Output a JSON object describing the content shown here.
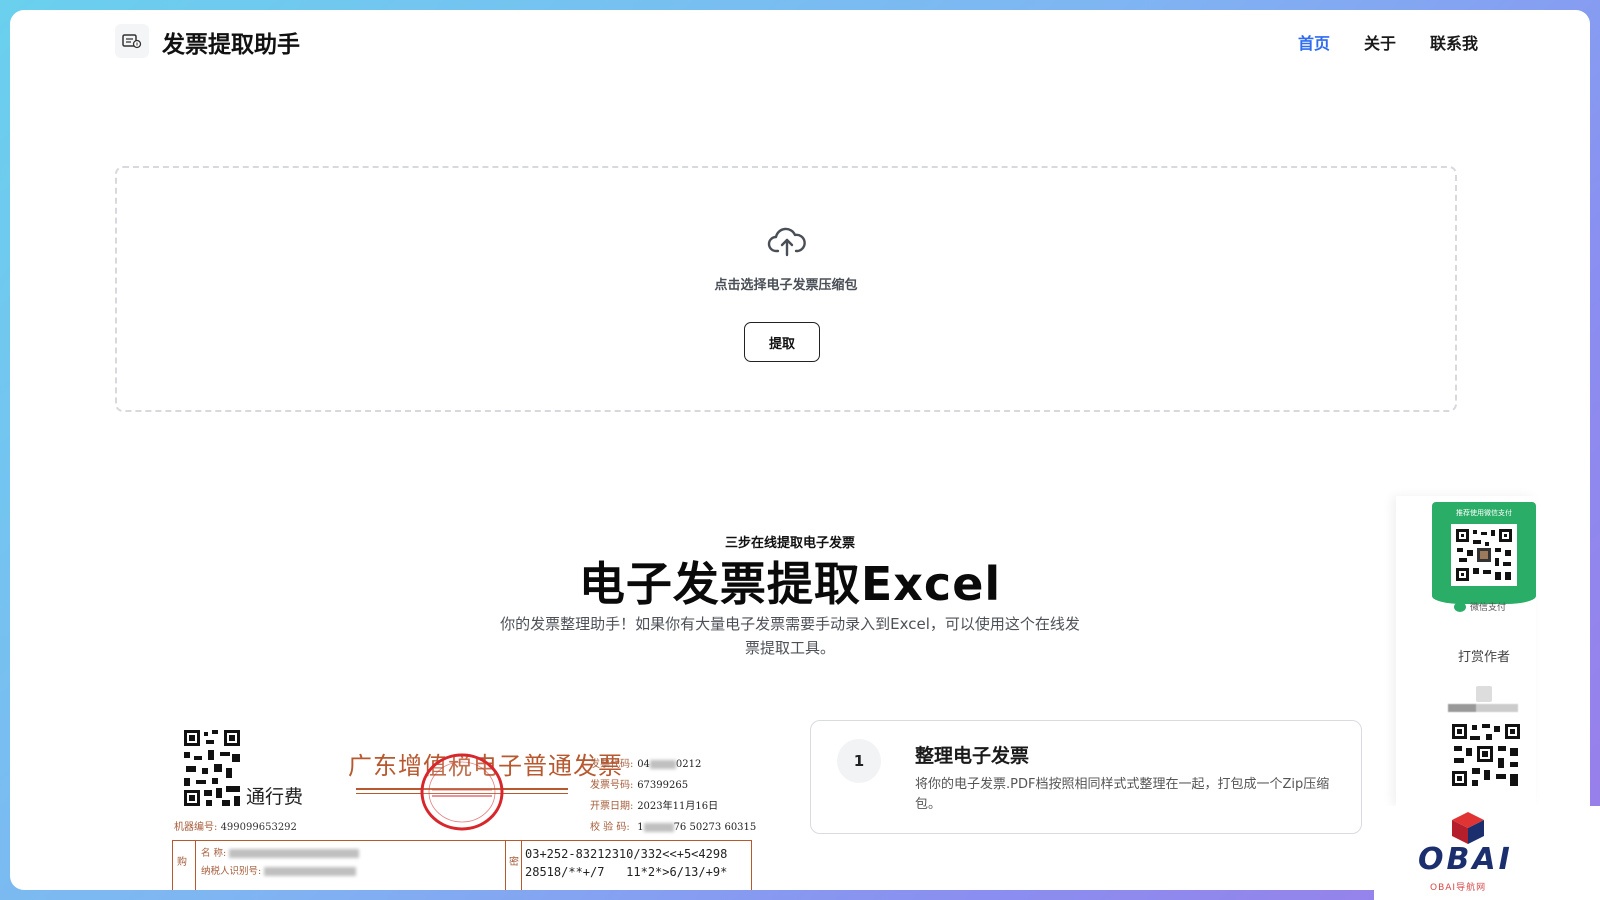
{
  "header": {
    "app_title": "发票提取助手",
    "nav": [
      {
        "label": "首页",
        "active": true
      },
      {
        "label": "关于",
        "active": false
      },
      {
        "label": "联系我",
        "active": false
      }
    ]
  },
  "upload": {
    "prompt": "点击选择电子发票压缩包",
    "extract_button": "提取",
    "icon": "cloud-upload-icon"
  },
  "hero": {
    "kicker": "三步在线提取电子发票",
    "title": "电子发票提取Excel",
    "description": "你的发票整理助手！如果你有大量电子发票需要手动录入到Excel，可以使用这个在线发票提取工具。"
  },
  "invoice_preview": {
    "tag": "通行费",
    "machine_label": "机器编号:",
    "machine_no": "499099653292",
    "title": "广东增值税电子普通发票",
    "fields": [
      {
        "label": "发票代码:",
        "value": "04",
        "tail": "0212"
      },
      {
        "label": "发票号码:",
        "value": "67399265",
        "tail": ""
      },
      {
        "label": "开票日期:",
        "value": "2023年11月16日",
        "tail": ""
      },
      {
        "label": "校 验 码:",
        "value": "1",
        "tail": "76 50273 60315"
      }
    ],
    "buyer_label": "购",
    "row_name": "名      称:",
    "row_taxid": "纳税人识别号:",
    "cipher_label": "密",
    "cipher": "03+252-83212310/332<<+5<4298\n28518/**+/7   11*2*>6/13/+9*"
  },
  "steps": [
    {
      "number": "1",
      "title": "整理电子发票",
      "description": "将你的电子发票.PDF档按照相同样式式整理在一起，打包成一个Zip压缩包。"
    }
  ],
  "tip_panel": {
    "wechat_header": "推荐使用微信支付",
    "wechat_pay": "微信支付",
    "tip_label": "打赏作者"
  },
  "brand": {
    "name": "OBAI",
    "subtitle": "OBAI导航网"
  },
  "colors": {
    "nav_active": "#2f6cf0",
    "wechat_green": "#2aae67",
    "invoice_brown": "#b7582f",
    "seal_red": "#d8262d"
  }
}
